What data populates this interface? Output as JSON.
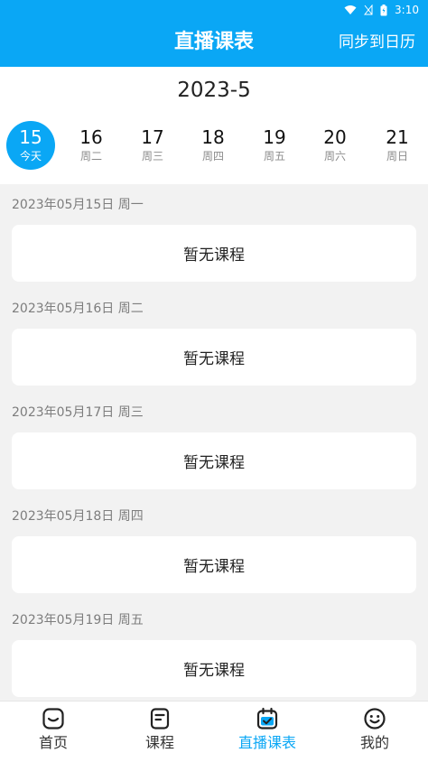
{
  "status_bar": {
    "time": "3:10"
  },
  "header": {
    "title": "直播课表",
    "action_label": "同步到日历"
  },
  "calendar": {
    "month": "2023-5",
    "days": [
      {
        "num": "15",
        "label": "今天",
        "active": true
      },
      {
        "num": "16",
        "label": "周二",
        "active": false
      },
      {
        "num": "17",
        "label": "周三",
        "active": false
      },
      {
        "num": "18",
        "label": "周四",
        "active": false
      },
      {
        "num": "19",
        "label": "周五",
        "active": false
      },
      {
        "num": "20",
        "label": "周六",
        "active": false
      },
      {
        "num": "21",
        "label": "周日",
        "active": false
      }
    ]
  },
  "schedule": [
    {
      "date": "2023年05月15日 周一",
      "empty_text": "暂无课程"
    },
    {
      "date": "2023年05月16日 周二",
      "empty_text": "暂无课程"
    },
    {
      "date": "2023年05月17日 周三",
      "empty_text": "暂无课程"
    },
    {
      "date": "2023年05月18日 周四",
      "empty_text": "暂无课程"
    },
    {
      "date": "2023年05月19日 周五",
      "empty_text": "暂无课程"
    }
  ],
  "bottom_nav": {
    "items": [
      {
        "label": "首页",
        "icon": "home-icon"
      },
      {
        "label": "课程",
        "icon": "course-icon"
      },
      {
        "label": "直播课表",
        "icon": "calendar-check-icon",
        "active": true
      },
      {
        "label": "我的",
        "icon": "smiley-icon"
      }
    ]
  },
  "colors": {
    "accent": "#0aa7f5",
    "background": "#f2f2f2"
  }
}
